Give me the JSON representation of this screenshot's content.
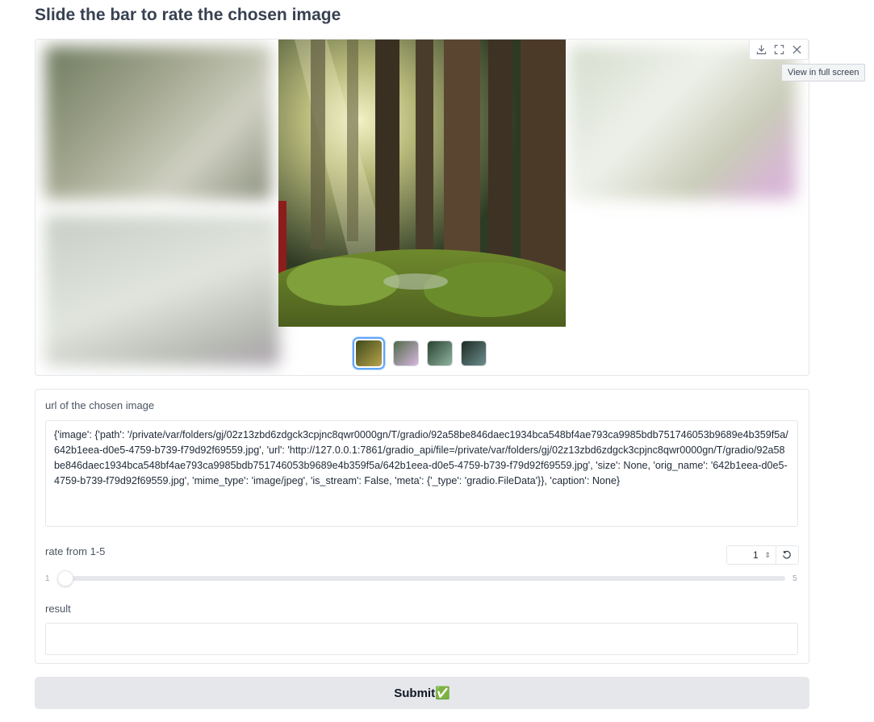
{
  "page": {
    "title": "Slide the bar to rate the chosen image"
  },
  "gallery": {
    "toolbar": {
      "download_icon": "download-icon",
      "fullscreen_icon": "fullscreen-icon",
      "close_icon": "close-icon"
    },
    "tooltip": "View in full screen",
    "thumbnails": [
      {
        "colors": [
          "#3e4a1c",
          "#b8a34a"
        ],
        "selected": true
      },
      {
        "colors": [
          "#4f6a47",
          "#d8b7e0"
        ],
        "selected": false
      },
      {
        "colors": [
          "#29422f",
          "#8fb4a0"
        ],
        "selected": false
      },
      {
        "colors": [
          "#1e2a22",
          "#6c8f8f"
        ],
        "selected": false
      }
    ]
  },
  "url_field": {
    "label": "url of the chosen image",
    "value": "{'image': {'path': '/private/var/folders/gj/02z13zbd6zdgck3cpjnc8qwr0000gn/T/gradio/92a58be846daec1934bca548bf4ae793ca9985bdb751746053b9689e4b359f5a/642b1eea-d0e5-4759-b739-f79d92f69559.jpg', 'url': 'http://127.0.0.1:7861/gradio_api/file=/private/var/folders/gj/02z13zbd6zdgck3cpjnc8qwr0000gn/T/gradio/92a58be846daec1934bca548bf4ae793ca9985bdb751746053b9689e4b359f5a/642b1eea-d0e5-4759-b739-f79d92f69559.jpg', 'size': None, 'orig_name': '642b1eea-d0e5-4759-b739-f79d92f69559.jpg', 'mime_type': 'image/jpeg', 'is_stream': False, 'meta': {'_type': 'gradio.FileData'}}, 'caption': None}"
  },
  "rating": {
    "label": "rate from 1-5",
    "value": "1",
    "min": "1",
    "max": "5"
  },
  "result": {
    "label": "result",
    "value": ""
  },
  "submit": {
    "label": "Submit✅"
  }
}
